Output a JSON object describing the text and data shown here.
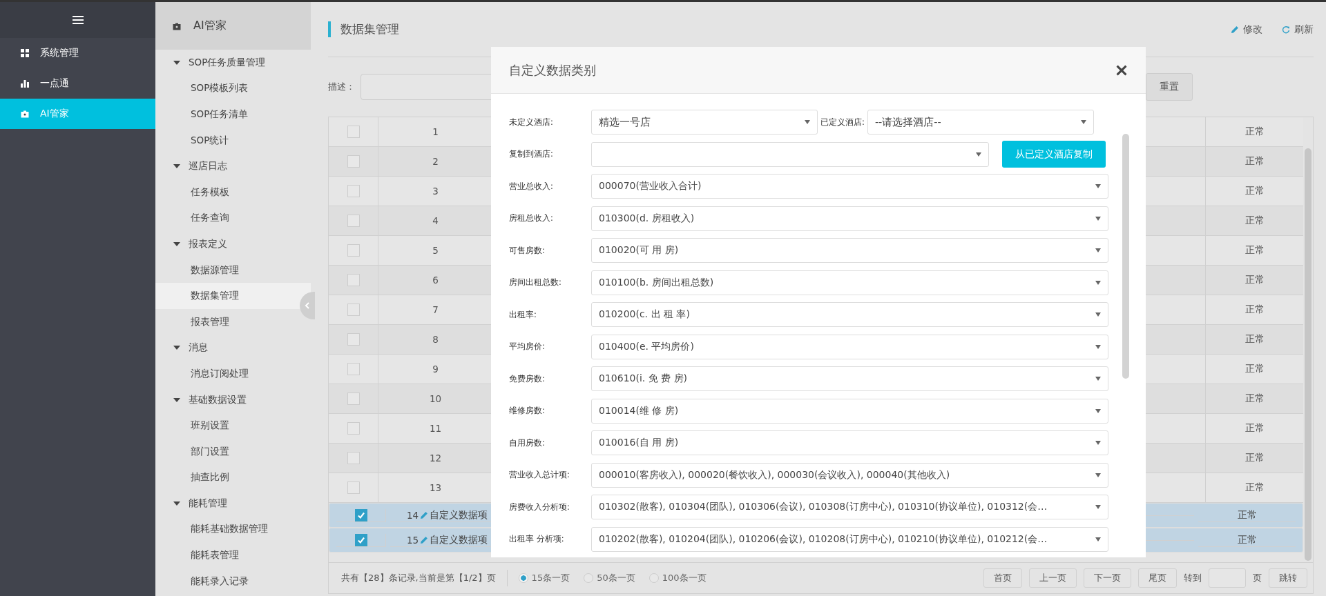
{
  "nav": {
    "items": [
      {
        "label": "系统管理",
        "selected": false
      },
      {
        "label": "一点通",
        "selected": false
      },
      {
        "label": "AI管家",
        "selected": true
      }
    ]
  },
  "subnav": {
    "title": "AI管家",
    "groups": [
      {
        "label": "SOP任务质量管理",
        "expanded": true,
        "children": [
          {
            "label": "SOP模板列表",
            "selected": false
          },
          {
            "label": "SOP任务清单",
            "selected": false
          },
          {
            "label": "SOP统计",
            "selected": false
          }
        ]
      },
      {
        "label": "巡店日志",
        "expanded": true,
        "children": [
          {
            "label": "任务模板",
            "selected": false
          },
          {
            "label": "任务查询",
            "selected": false
          }
        ]
      },
      {
        "label": "报表定义",
        "expanded": true,
        "children": [
          {
            "label": "数据源管理",
            "selected": false
          },
          {
            "label": "数据集管理",
            "selected": true
          },
          {
            "label": "报表管理",
            "selected": false
          }
        ]
      },
      {
        "label": "消息",
        "expanded": true,
        "children": [
          {
            "label": "消息订阅处理",
            "selected": false
          }
        ]
      },
      {
        "label": "基础数据设置",
        "expanded": true,
        "children": [
          {
            "label": "班别设置",
            "selected": false
          },
          {
            "label": "部门设置",
            "selected": false
          },
          {
            "label": "抽查比例",
            "selected": false
          }
        ]
      },
      {
        "label": "能耗管理",
        "expanded": true,
        "children": [
          {
            "label": "能耗基础数据管理",
            "selected": false
          },
          {
            "label": "能耗表管理",
            "selected": false
          },
          {
            "label": "能耗录入记录",
            "selected": false
          }
        ]
      }
    ]
  },
  "page": {
    "title": "数据集管理",
    "actions": [
      {
        "kind": "edit",
        "label": "修改"
      },
      {
        "kind": "refresh",
        "label": "刷新"
      }
    ]
  },
  "filter": {
    "label": "描述：",
    "reset": "重置"
  },
  "table": {
    "rows": [
      {
        "selected": false,
        "number": "1",
        "status": "正常"
      },
      {
        "selected": false,
        "number": "2",
        "status": "正常"
      },
      {
        "selected": false,
        "number": "3",
        "status": "正常"
      },
      {
        "selected": false,
        "number": "4",
        "status": "正常"
      },
      {
        "selected": false,
        "number": "5",
        "status": "正常"
      },
      {
        "selected": false,
        "number": "6",
        "status": "正常"
      },
      {
        "selected": false,
        "number": "7",
        "status": "正常"
      },
      {
        "selected": false,
        "number": "8",
        "status": "正常"
      },
      {
        "selected": false,
        "number": "9",
        "status": "正常"
      },
      {
        "selected": false,
        "number": "10",
        "status": "正常"
      },
      {
        "selected": false,
        "number": "11",
        "status": "正常"
      },
      {
        "selected": false,
        "number": "12",
        "status": "正常"
      },
      {
        "selected": false,
        "number": "13",
        "status": "正常"
      },
      {
        "selected": true,
        "number": "14",
        "link": "自定义数据项",
        "status": "正常"
      },
      {
        "selected": true,
        "number": "15",
        "link": "自定义数据项",
        "status": "正常"
      }
    ]
  },
  "pagination": {
    "summary": "共有【28】条记录,当前是第【1/2】页",
    "page_sizes": [
      {
        "label": "15条一页",
        "selected": true
      },
      {
        "label": "50条一页",
        "selected": false
      },
      {
        "label": "100条一页",
        "selected": false
      }
    ],
    "buttons": [
      "首页",
      "上一页",
      "下一页",
      "尾页"
    ],
    "goto_label": "转到",
    "page_unit": "页",
    "jump": "跳转"
  },
  "modal": {
    "title": "自定义数据类别",
    "hotel_row": {
      "undefined_label": "未定义酒店:",
      "undefined_value": "精选一号店",
      "defined_label": "已定义酒店:",
      "defined_value": "--请选择酒店--"
    },
    "copy_row": {
      "label": "复制到酒店:",
      "button": "从已定义酒店复制"
    },
    "fields": [
      {
        "label": "营业总收入:",
        "value": "000070(营业收入合计)"
      },
      {
        "label": "房租总收入:",
        "value": "010300(d. 房租收入)"
      },
      {
        "label": "可售房数:",
        "value": "010020(可 用 房)"
      },
      {
        "label": "房间出租总数:",
        "value": "010100(b. 房间出租总数)"
      },
      {
        "label": "出租率:",
        "value": "010200(c. 出 租 率)"
      },
      {
        "label": "平均房价:",
        "value": "010400(e. 平均房价)"
      },
      {
        "label": "免费房数:",
        "value": "010610(i. 免 费 房)"
      },
      {
        "label": "维修房数:",
        "value": "010014(维 修 房)"
      },
      {
        "label": "自用房数:",
        "value": "010016(自 用 房)"
      },
      {
        "label": "营业收入总计项:",
        "value": "000010(客房收入), 000020(餐饮收入), 000030(会议收入), 000040(其他收入)"
      },
      {
        "label": "房费收入分析项:",
        "value": "010302(散客), 010304(团队), 010306(会议), 010308(订房中心), 010310(协议单位), 010312(会…"
      },
      {
        "label": "出租率 分析项:",
        "value": "010202(散客), 010204(团队), 010206(会议), 010208(订房中心), 010210(协议单位), 010212(会…"
      }
    ]
  }
}
